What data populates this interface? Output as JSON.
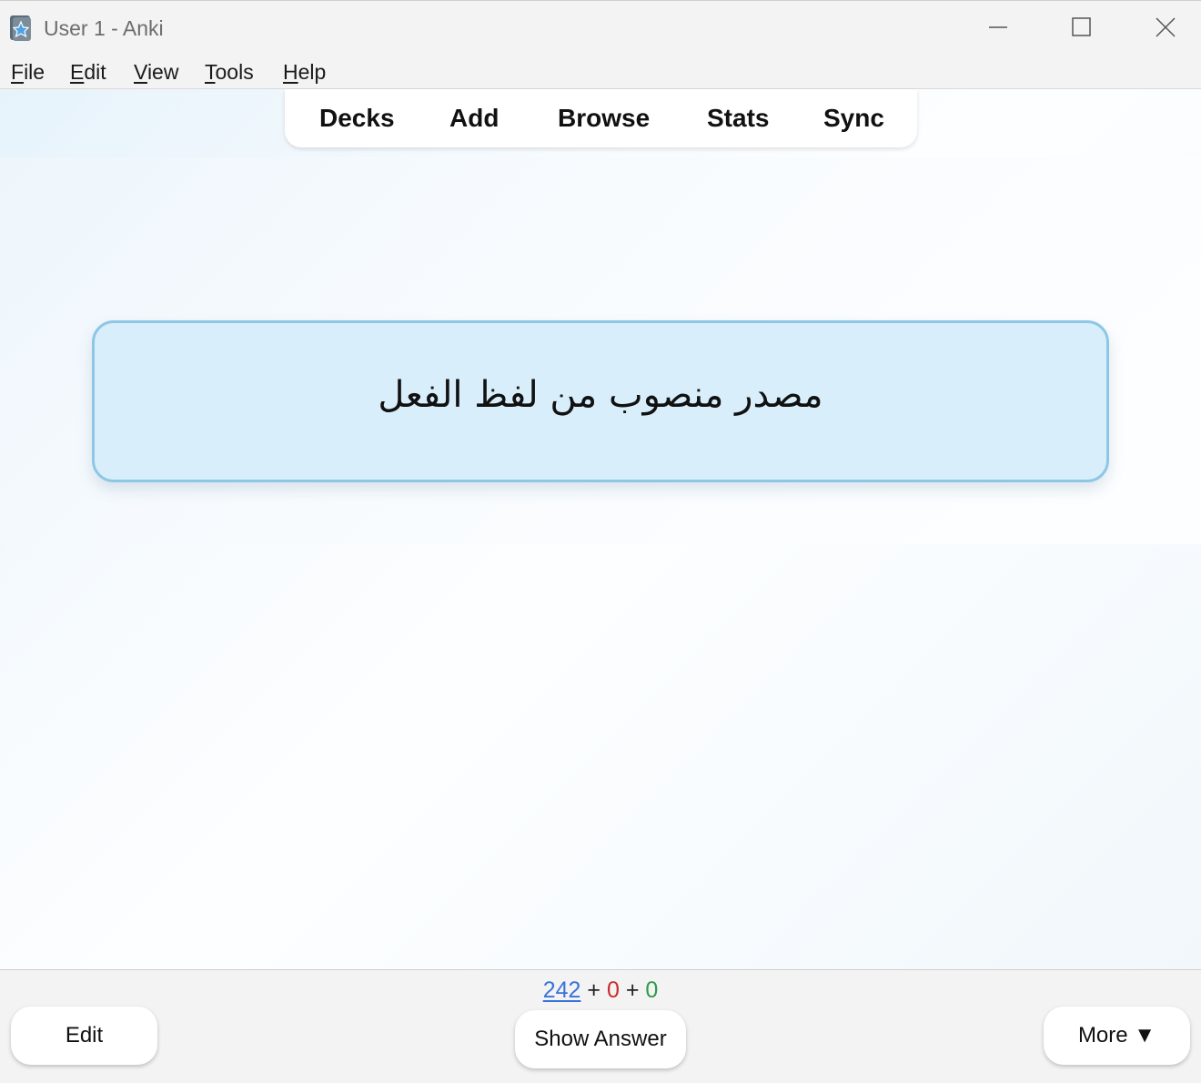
{
  "window": {
    "title": "User 1 - Anki",
    "icon": "anki-app-icon"
  },
  "menubar": {
    "items": [
      {
        "key": "F",
        "rest": "ile"
      },
      {
        "key": "E",
        "rest": "dit"
      },
      {
        "key": "V",
        "rest": "iew"
      },
      {
        "key": "T",
        "rest": "ools"
      },
      {
        "key": "H",
        "rest": "elp"
      }
    ]
  },
  "toolbar": {
    "tabs": [
      "Decks",
      "Add",
      "Browse",
      "Stats",
      "Sync"
    ]
  },
  "card": {
    "front_text": "مصدر منصوب من لفظ الفعل"
  },
  "bottom": {
    "counts": {
      "new": "242",
      "learning": "0",
      "review": "0",
      "separator": "+"
    },
    "edit_label": "Edit",
    "show_answer_label": "Show Answer",
    "more_label": "More ▼"
  },
  "colors": {
    "card_bg": "#d8eefb",
    "card_border": "#8ec7e6",
    "new_count": "#3a73d8",
    "learning_count": "#cc2a2a",
    "review_count": "#2e9a49"
  }
}
